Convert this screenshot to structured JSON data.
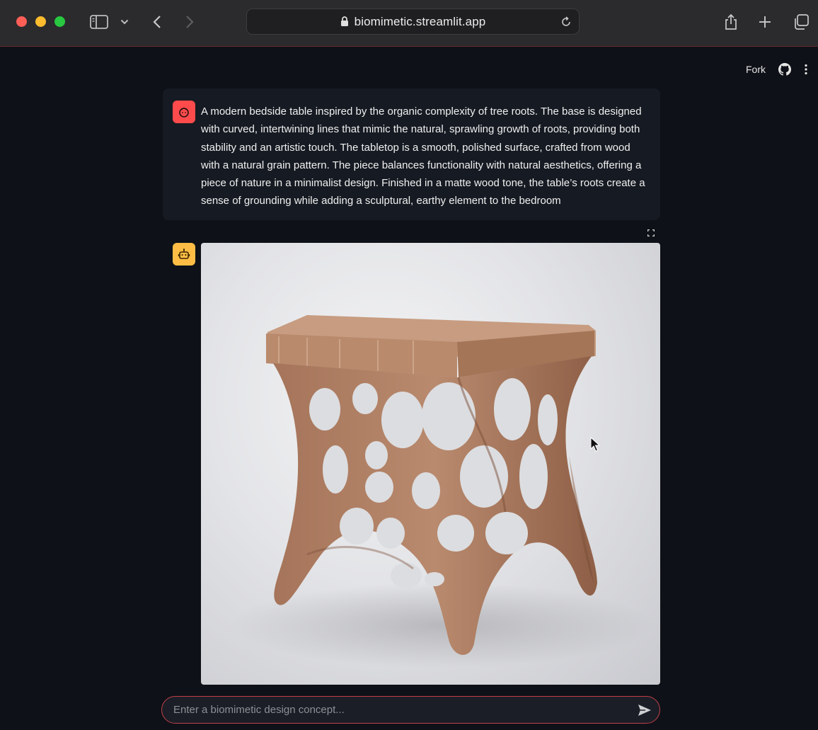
{
  "browser": {
    "url": "biomimetic.streamlit.app"
  },
  "toolbar": {
    "fork_label": "Fork"
  },
  "chat": {
    "user_message": "A modern bedside table inspired by the organic complexity of tree roots. The base is designed with curved, intertwining lines that mimic the natural, sprawling growth of roots, providing both stability and an artistic touch. The tabletop is a smooth, polished surface, crafted from wood with a natural grain pattern. The piece balances functionality with natural aesthetics, offering a piece of nature in a minimalist design. Finished in a matte wood tone, the table’s roots create a sense of grounding while adding a sculptural, earthy element to the bedroom",
    "input_placeholder": "Enter a biomimetic design concept..."
  },
  "colors": {
    "app_bg": "#0e1117",
    "user_avatar": "#ff4b4b",
    "bot_avatar": "#ffbd45",
    "input_border": "#c2404a"
  }
}
